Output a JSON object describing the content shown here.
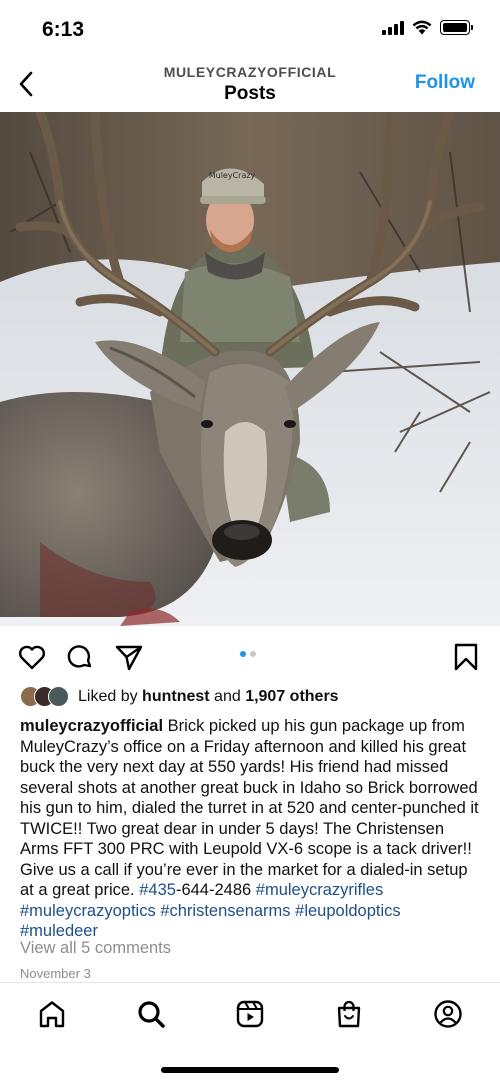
{
  "status_bar": {
    "time": "6:13"
  },
  "header": {
    "account": "MULEYCRAZYOFFICIAL",
    "title": "Posts",
    "follow_label": "Follow"
  },
  "photo": {
    "cap_text": "MuleyCrazy"
  },
  "carousel": {
    "total": 2,
    "active_index": 0
  },
  "likes": {
    "prefix": "Liked by ",
    "user": "huntnest",
    "joiner": " and ",
    "others": "1,907 others"
  },
  "caption": {
    "username": "muleycrazyofficial",
    "text": " Brick picked up his gun package up from MuleyCrazy’s office on a Friday afternoon and killed his great buck the very next day at 550 yards! His friend had missed several shots at another great buck in Idaho so Brick borrowed his gun to him, dialed the turret in at 520 and center-punched it TWICE!! Two great dear in under 5 days! The Christensen Arms FFT 300 PRC with Leupold VX-6 scope is a tack driver!! Give us a call if you’re ever in the market for a dialed-in setup at a great price. ",
    "hashtags": [
      "#435",
      "#muleycrazyrifles",
      "#muleycrazyoptics",
      "#christensenarms",
      "#leupoldoptics",
      "#muledeer"
    ],
    "phone_rest": "-644-2486"
  },
  "comments": {
    "view_all": "View all 5 comments"
  },
  "date": "November 3",
  "icons": {
    "back": "chevron-left-icon",
    "like": "heart-icon",
    "comment": "comment-icon",
    "share": "send-icon",
    "save": "bookmark-icon",
    "home": "home-icon",
    "search": "search-icon",
    "reels": "reels-icon",
    "shop": "shop-icon",
    "profile": "profile-icon"
  },
  "colors": {
    "accent": "#1f93e6",
    "hashtag": "#1f4f8a",
    "muted": "#8e8e8e"
  }
}
